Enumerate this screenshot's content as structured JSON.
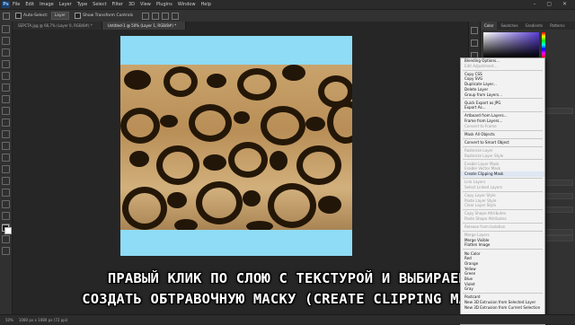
{
  "menubar": {
    "logo": "Ps",
    "items": [
      "File",
      "Edit",
      "Image",
      "Layer",
      "Type",
      "Select",
      "Filter",
      "3D",
      "View",
      "Plugins",
      "Window",
      "Help"
    ]
  },
  "options": {
    "auto_select": "Auto-Select:",
    "auto_select_value": "Layer",
    "show_transform": "Show Transform Controls"
  },
  "tabs": [
    "SEPCTA.jpg @ 66,7% (Layer 0, RGB/8#) *",
    "Untitled-1 @ 50% (Layer 1, RGB/8#) *"
  ],
  "panel_tabs": [
    "Color",
    "Swatches",
    "Gradients",
    "Patterns"
  ],
  "context_menu": [
    {
      "t": "Blending Options...",
      "d": false
    },
    {
      "t": "Edit Adjustment...",
      "d": true
    },
    {
      "sep": true
    },
    {
      "t": "Copy CSS",
      "d": false
    },
    {
      "t": "Copy SVG",
      "d": false
    },
    {
      "t": "Duplicate Layer...",
      "d": false
    },
    {
      "t": "Delete Layer",
      "d": false
    },
    {
      "t": "Group from Layers...",
      "d": false
    },
    {
      "sep": true
    },
    {
      "t": "Quick Export as JPG",
      "d": false
    },
    {
      "t": "Export As...",
      "d": false
    },
    {
      "sep": true
    },
    {
      "t": "Artboard from Layers...",
      "d": false
    },
    {
      "t": "Frame from Layers...",
      "d": false
    },
    {
      "t": "Convert to Frame",
      "d": true
    },
    {
      "sep": true
    },
    {
      "t": "Mask All Objects",
      "d": false
    },
    {
      "sep": true
    },
    {
      "t": "Convert to Smart Object",
      "d": false
    },
    {
      "sep": true
    },
    {
      "t": "Rasterize Layer",
      "d": true
    },
    {
      "t": "Rasterize Layer Style",
      "d": true
    },
    {
      "sep": true
    },
    {
      "t": "Enable Layer Mask",
      "d": true
    },
    {
      "t": "Enable Vector Mask",
      "d": true
    },
    {
      "t": "Create Clipping Mask",
      "d": false,
      "hl": true
    },
    {
      "sep": true
    },
    {
      "t": "Link Layers",
      "d": true
    },
    {
      "t": "Select Linked Layers",
      "d": true
    },
    {
      "sep": true
    },
    {
      "t": "Copy Layer Style",
      "d": true
    },
    {
      "t": "Paste Layer Style",
      "d": true
    },
    {
      "t": "Clear Layer Style",
      "d": true
    },
    {
      "sep": true
    },
    {
      "t": "Copy Shape Attributes",
      "d": true
    },
    {
      "t": "Paste Shape Attributes",
      "d": true
    },
    {
      "sep": true
    },
    {
      "t": "Release from Isolation",
      "d": true
    },
    {
      "sep": true
    },
    {
      "t": "Merge Layers",
      "d": true
    },
    {
      "t": "Merge Visible",
      "d": false
    },
    {
      "t": "Flatten Image",
      "d": false
    },
    {
      "sep": true
    },
    {
      "t": "No Color",
      "d": false
    },
    {
      "t": "Red",
      "d": false
    },
    {
      "t": "Orange",
      "d": false
    },
    {
      "t": "Yellow",
      "d": false
    },
    {
      "t": "Green",
      "d": false
    },
    {
      "t": "Blue",
      "d": false
    },
    {
      "t": "Violet",
      "d": false
    },
    {
      "t": "Gray",
      "d": false
    },
    {
      "sep": true
    },
    {
      "t": "Postcard",
      "d": false
    },
    {
      "t": "New 3D Extrusion from Selected Layer",
      "d": false
    },
    {
      "t": "New 3D Extrusion from Current Selection",
      "d": false
    }
  ],
  "caption": {
    "line1": "ПРАВЫЙ КЛИК ПО СЛОЮ С ТЕКСТУРОЙ И ВЫБИРАЕМ",
    "line2": "СОЗДАТЬ ОБТРАВОЧНУЮ МАСКУ (CREATE CLIPPING MASK)"
  },
  "status": {
    "zoom": "50%",
    "doc_size": "1080 px x 1080 px (72 ppi)"
  },
  "colors": {
    "canvas_fill": "#8fdcf6",
    "ui_dark": "#262626"
  }
}
